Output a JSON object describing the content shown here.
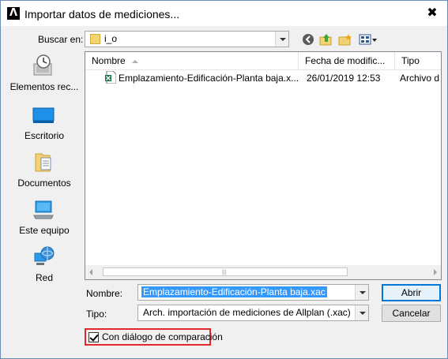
{
  "window": {
    "title": "Importar datos de mediciones...",
    "app_icon_glyph": "Λ",
    "close_glyph": "✖"
  },
  "lookin": {
    "label": "Buscar en:",
    "value": "i_o"
  },
  "places": [
    {
      "label": "Elementos rec...",
      "icon": "recent-items-icon"
    },
    {
      "label": "Escritorio",
      "icon": "desktop-icon"
    },
    {
      "label": "Documentos",
      "icon": "documents-icon"
    },
    {
      "label": "Este equipo",
      "icon": "computer-icon"
    },
    {
      "label": "Red",
      "icon": "network-icon"
    }
  ],
  "filelist": {
    "columns": [
      "Nombre",
      "Fecha de modific...",
      "Tipo"
    ],
    "rows": [
      {
        "name": "Emplazamiento-Edificación-Planta baja.x...",
        "date": "26/01/2019 12:53",
        "type": "Archivo d"
      }
    ],
    "grip": "|||"
  },
  "filename": {
    "label": "Nombre:",
    "value": "Emplazamiento-Edificación-Planta baja.xac"
  },
  "filetype": {
    "label": "Tipo:",
    "value": "Arch. importación de mediciones de Allplan (.xac)"
  },
  "buttons": {
    "open": "Abrir",
    "cancel": "Cancelar"
  },
  "compare": {
    "label": "Con diálogo de comparación",
    "checked": true
  },
  "colors": {
    "accent": "#0078d7",
    "highlight_border": "#e3282d",
    "selection": "#3399ff"
  }
}
